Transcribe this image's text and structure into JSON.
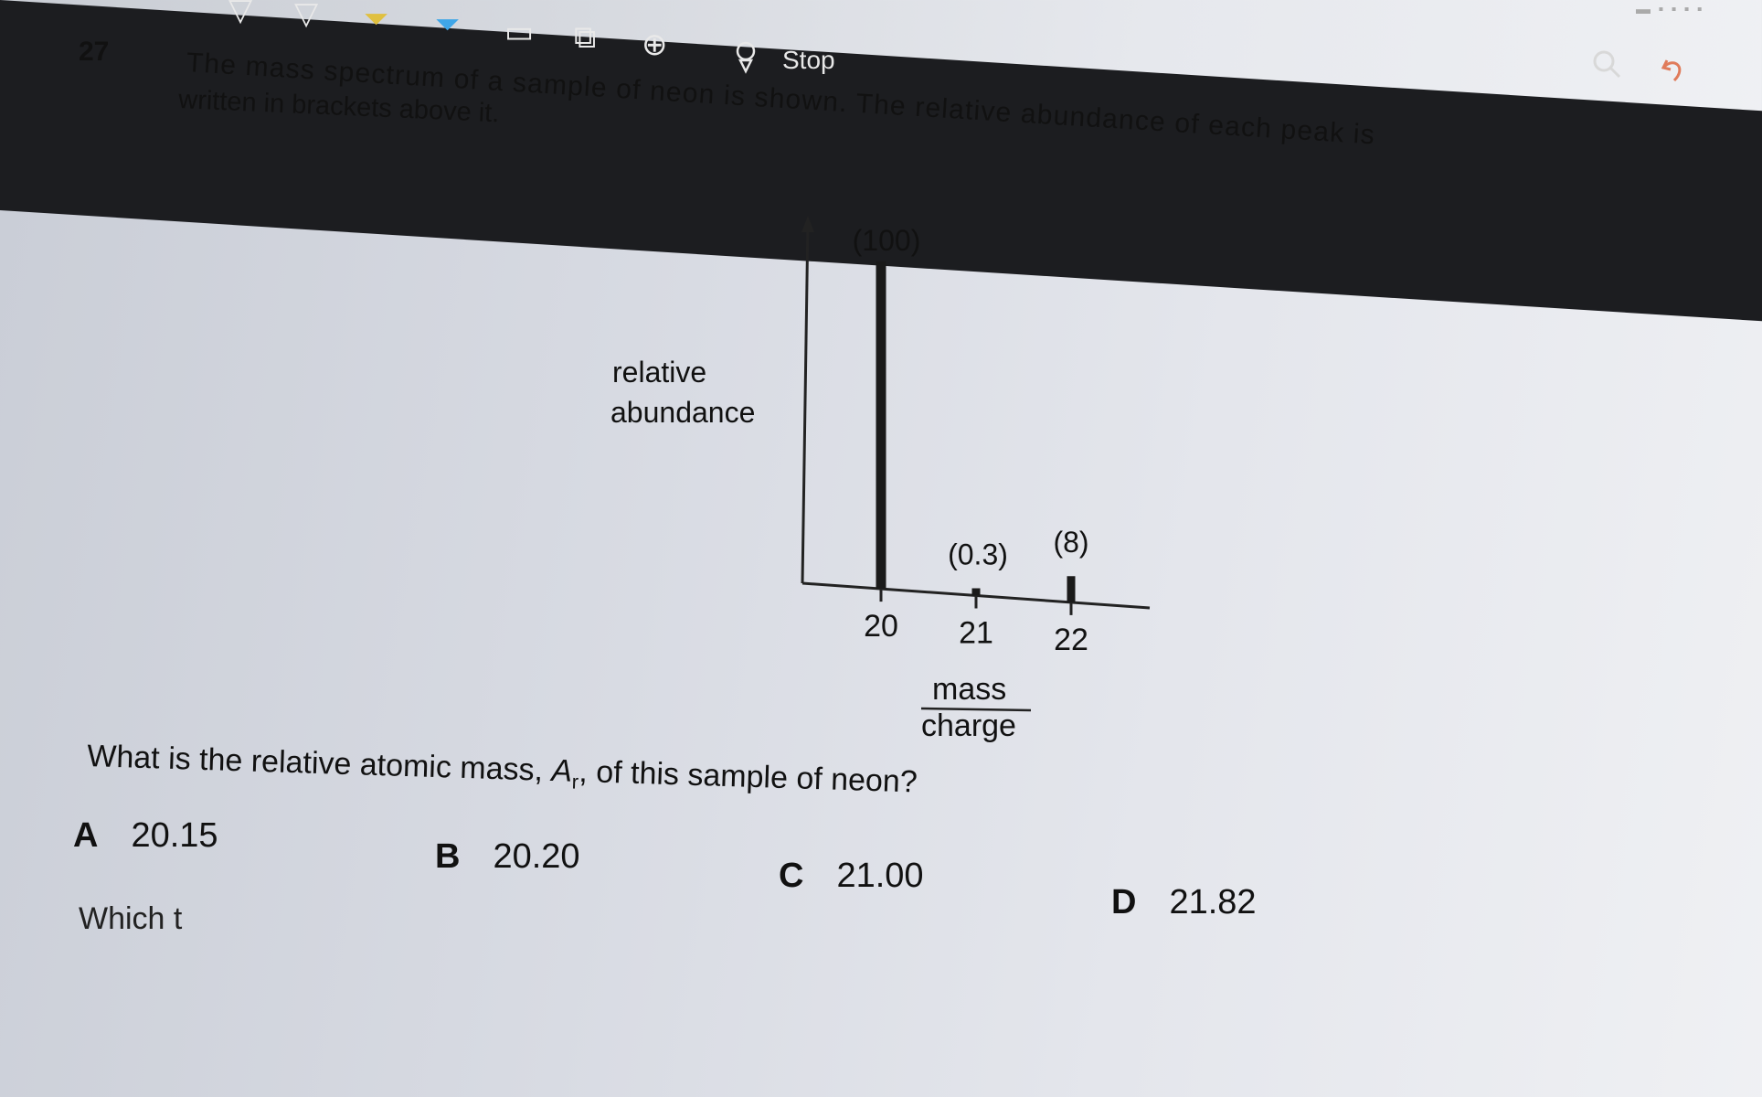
{
  "toolbar": {
    "stop_label": "Stop",
    "icons": [
      "highlighter-icon",
      "highlighter-icon",
      "highlighter-icon",
      "shape-icon",
      "shape-icon",
      "add-shape-icon",
      "lasso-icon",
      "search-icon",
      "undo-icon"
    ]
  },
  "question": {
    "number": "27",
    "line1": "The mass spectrum of a sample of neon is shown. The relative abundance of each peak is",
    "line2": "written in brackets above it.",
    "prompt_before": "What is the relative atomic mass, ",
    "prompt_symbol": "A",
    "prompt_sub": "r",
    "prompt_after": ", of this sample of neon?",
    "next_partial": "Which t"
  },
  "options": [
    {
      "letter": "A",
      "value": "20.15"
    },
    {
      "letter": "B",
      "value": "20.20"
    },
    {
      "letter": "C",
      "value": "21.00"
    },
    {
      "letter": "D",
      "value": "21.82"
    }
  ],
  "chart_data": {
    "type": "bar",
    "ylabel_line1": "relative",
    "ylabel_line2": "abundance",
    "xlabel_top": "mass",
    "xlabel_bottom": "charge",
    "x": [
      20,
      21,
      22
    ],
    "x_tick_labels": [
      "20",
      "21",
      "22"
    ],
    "values": [
      100,
      0.3,
      8
    ],
    "value_labels": [
      "(100)",
      "(0.3)",
      "(8)"
    ],
    "ylim": [
      0,
      100
    ],
    "grid": false
  }
}
